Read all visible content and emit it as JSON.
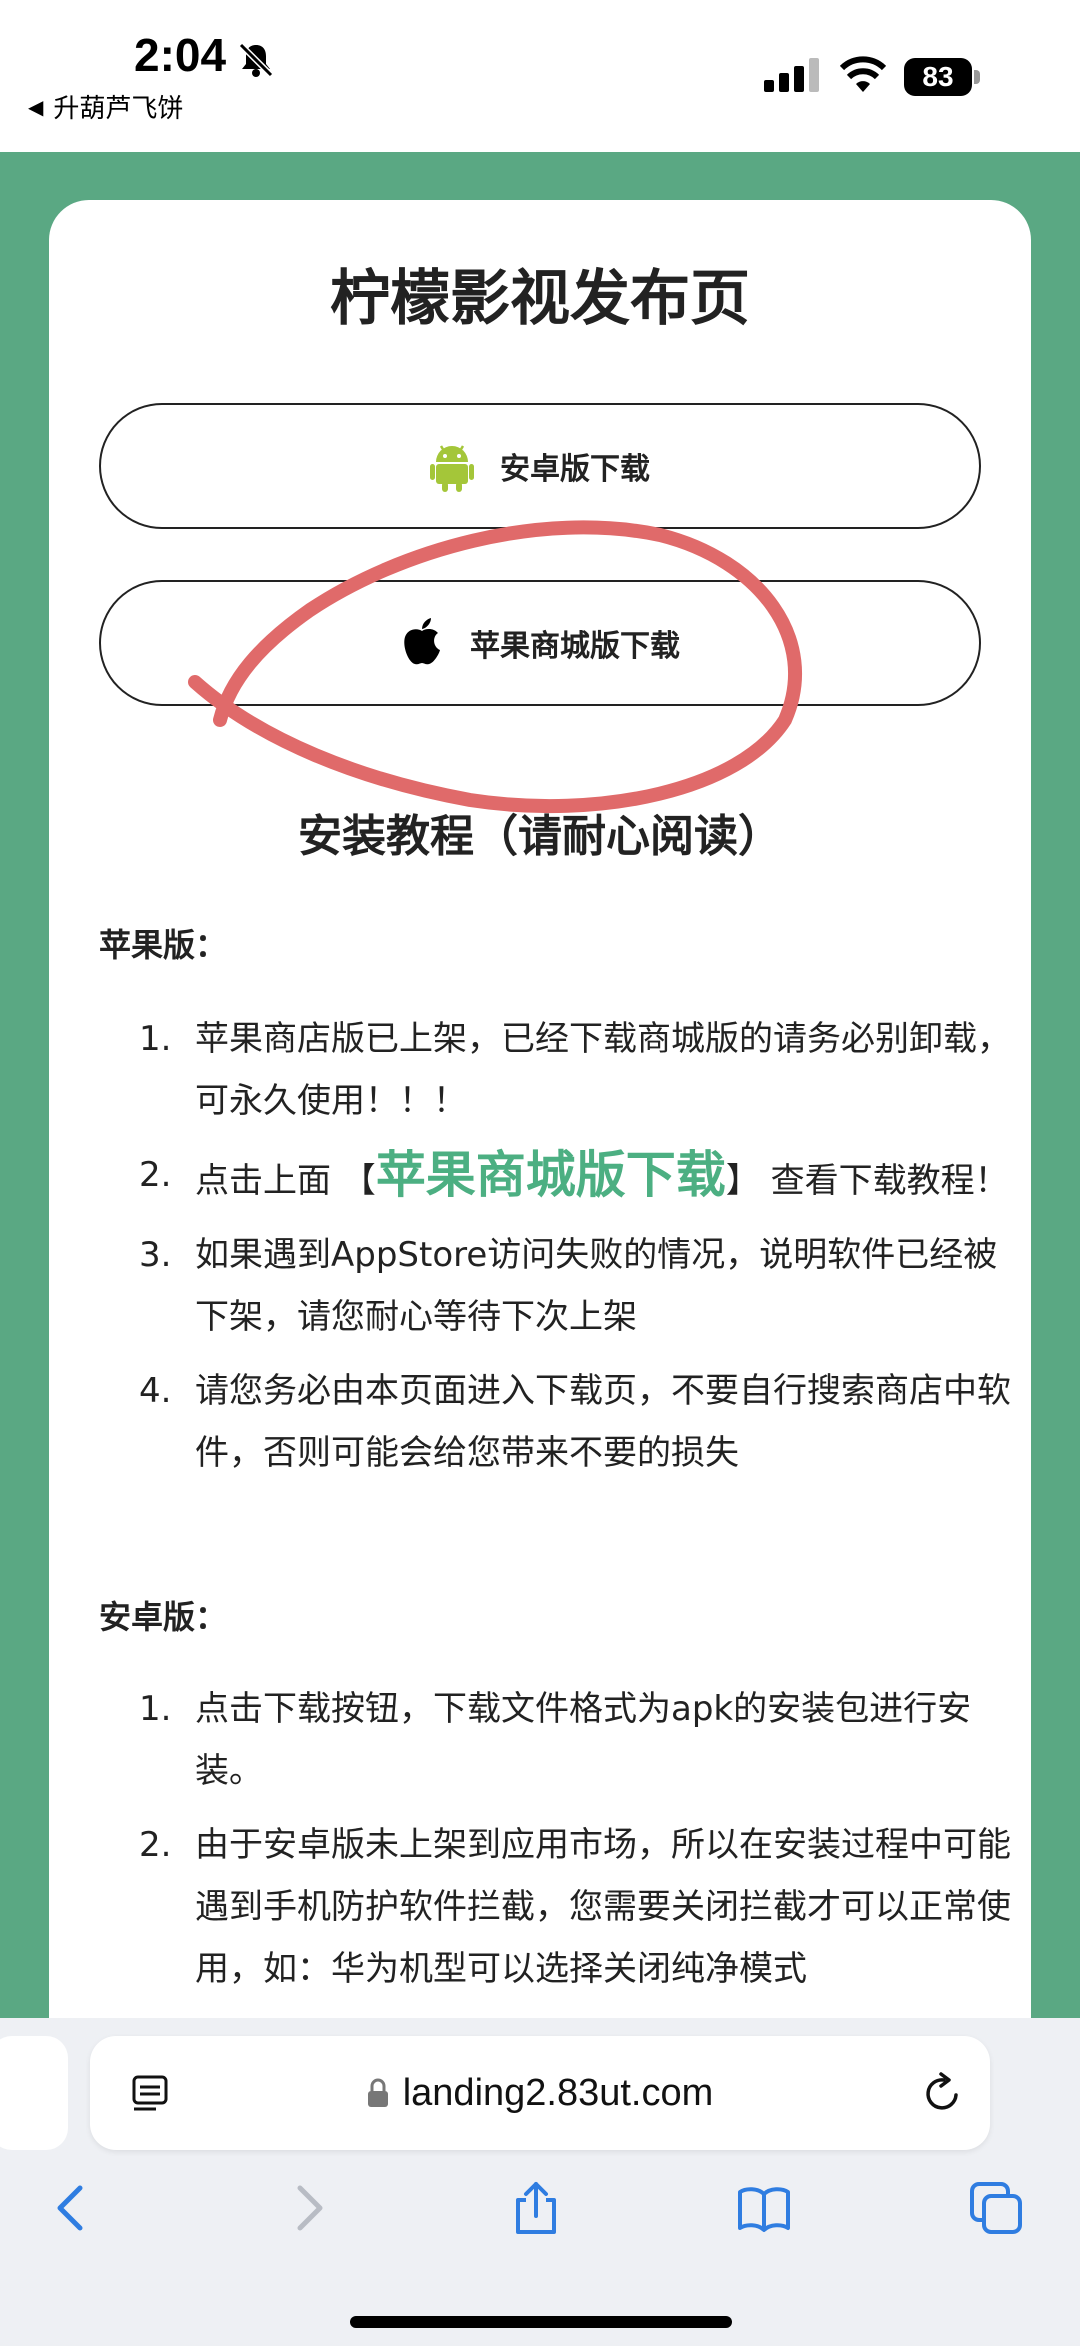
{
  "status_bar": {
    "time": "2:04",
    "back_app": "升葫芦飞饼",
    "battery": "83"
  },
  "page": {
    "title": "柠檬影视发布页",
    "android_button": "安卓版下载",
    "ios_button": "苹果商城版下载",
    "tutorial_title": "安装教程（请耐心阅读）",
    "ios_section": {
      "heading": "苹果版：",
      "items": [
        {
          "num": "1.",
          "text": "苹果商店版已上架，已经下载商城版的请务必别卸载，可永久使用！！！"
        },
        {
          "num": "2.",
          "pre": "点击上面 【",
          "highlight": "苹果商城版下载",
          "post": "】 查看下载教程！"
        },
        {
          "num": "3.",
          "text": "如果遇到AppStore访问失败的情况，说明软件已经被下架，请您耐心等待下次上架"
        },
        {
          "num": "4.",
          "text": "请您务必由本页面进入下载页，不要自行搜索商店中软件，否则可能会给您带来不要的损失"
        }
      ]
    },
    "android_section": {
      "heading": "安卓版：",
      "items": [
        {
          "num": "1.",
          "text": "点击下载按钮，下载文件格式为apk的安装包进行安装。"
        },
        {
          "num": "2.",
          "text": "由于安卓版未上架到应用市场，所以在安装过程中可能遇到手机防护软件拦截，您需要关闭拦截才可以正常使用，如：华为机型可以选择关闭纯净模式"
        }
      ]
    }
  },
  "colors": {
    "page_background": "#5aa883",
    "highlight": "#4caf82",
    "annotation": "#e06a6a",
    "android_green": "#a4c639"
  },
  "browser": {
    "url": "landing2.83ut.com"
  }
}
